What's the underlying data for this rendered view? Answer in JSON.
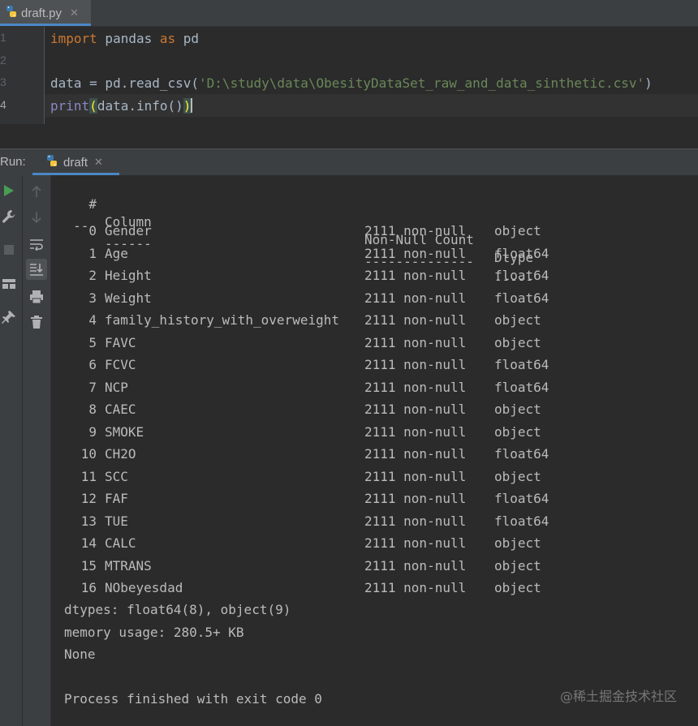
{
  "editor": {
    "tab": {
      "filename": "draft.py",
      "close": "✕"
    },
    "line_numbers": [
      "1",
      "2",
      "3",
      "4"
    ],
    "lines": {
      "l1": {
        "k1": "import",
        "t1": " pandas ",
        "k2": "as",
        "t2": " pd"
      },
      "l3": {
        "t1": "data = pd.read_csv(",
        "s1": "'D:\\study\\data\\ObesityDataSet_raw_and_data_sinthetic.csv'",
        "t2": ")"
      },
      "l4": {
        "b1": "print",
        "p1": "(",
        "t1": "data.info()",
        "p2": ")"
      }
    }
  },
  "run_panel": {
    "label": "Run:",
    "tab": {
      "label": "draft",
      "close": "✕"
    }
  },
  "console": {
    "header": {
      "idx": "#",
      "name": "Column",
      "count": "Non-Null Count",
      "dtype": "Dtype"
    },
    "divider": {
      "idx": "---",
      "name": "------",
      "count": "--------------",
      "dtype": "-----"
    },
    "rows": [
      {
        "idx": "0",
        "name": "Gender",
        "count": "2111 non-null",
        "dtype": "object"
      },
      {
        "idx": "1",
        "name": "Age",
        "count": "2111 non-null",
        "dtype": "float64"
      },
      {
        "idx": "2",
        "name": "Height",
        "count": "2111 non-null",
        "dtype": "float64"
      },
      {
        "idx": "3",
        "name": "Weight",
        "count": "2111 non-null",
        "dtype": "float64"
      },
      {
        "idx": "4",
        "name": "family_history_with_overweight",
        "count": "2111 non-null",
        "dtype": "object"
      },
      {
        "idx": "5",
        "name": "FAVC",
        "count": "2111 non-null",
        "dtype": "object"
      },
      {
        "idx": "6",
        "name": "FCVC",
        "count": "2111 non-null",
        "dtype": "float64"
      },
      {
        "idx": "7",
        "name": "NCP",
        "count": "2111 non-null",
        "dtype": "float64"
      },
      {
        "idx": "8",
        "name": "CAEC",
        "count": "2111 non-null",
        "dtype": "object"
      },
      {
        "idx": "9",
        "name": "SMOKE",
        "count": "2111 non-null",
        "dtype": "object"
      },
      {
        "idx": "10",
        "name": "CH2O",
        "count": "2111 non-null",
        "dtype": "float64"
      },
      {
        "idx": "11",
        "name": "SCC",
        "count": "2111 non-null",
        "dtype": "object"
      },
      {
        "idx": "12",
        "name": "FAF",
        "count": "2111 non-null",
        "dtype": "float64"
      },
      {
        "idx": "13",
        "name": "TUE",
        "count": "2111 non-null",
        "dtype": "float64"
      },
      {
        "idx": "14",
        "name": "CALC",
        "count": "2111 non-null",
        "dtype": "object"
      },
      {
        "idx": "15",
        "name": "MTRANS",
        "count": "2111 non-null",
        "dtype": "object"
      },
      {
        "idx": "16",
        "name": "NObeyesdad",
        "count": "2111 non-null",
        "dtype": "object"
      }
    ],
    "dtypes": "dtypes: float64(8), object(9)",
    "memory": "memory usage: 280.5+ KB",
    "none": "None",
    "exit": "Process finished with exit code 0"
  },
  "watermark": "@稀土掘金技术社区",
  "icons": {
    "file_tab": "python-file-icon",
    "run_tab": "python-file-icon",
    "toolbar_left": [
      "rerun-icon",
      "wrench-icon",
      "stop-icon",
      "layout-icon",
      "pin-icon"
    ],
    "toolbar_right": [
      "arrow-up-icon",
      "arrow-down-icon",
      "soft-wrap-icon",
      "scroll-to-end-icon",
      "print-icon",
      "trash-icon"
    ]
  },
  "colors": {
    "background": "#2b2b2b",
    "keyword": "#cc7832",
    "string": "#6a8759",
    "builtin": "#8888c6",
    "run_green": "#499c54",
    "accent": "#4a88c7"
  }
}
